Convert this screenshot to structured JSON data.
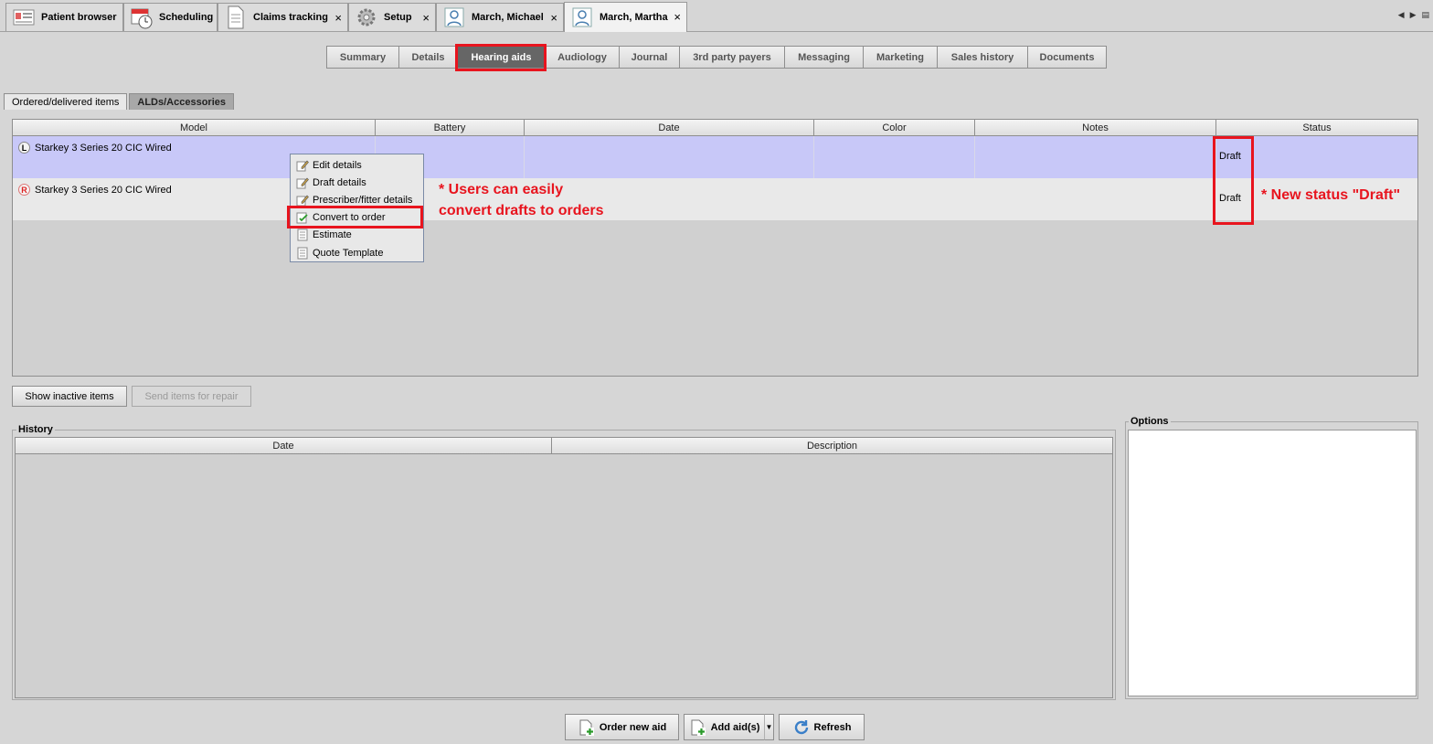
{
  "top_tabs": [
    {
      "label": "Patient browser",
      "icon": "patient-browser-icon",
      "closable": false,
      "active": false
    },
    {
      "label": "Scheduling",
      "icon": "calendar-clock-icon",
      "closable": false,
      "active": false
    },
    {
      "label": "Claims tracking",
      "icon": "document-icon",
      "closable": true,
      "active": false
    },
    {
      "label": "Setup",
      "icon": "gear-icon",
      "closable": true,
      "active": false
    },
    {
      "label": "March, Michael",
      "icon": "person-icon",
      "closable": true,
      "active": false
    },
    {
      "label": "March, Martha",
      "icon": "person-icon",
      "closable": true,
      "active": true
    }
  ],
  "close_glyph": "×",
  "sub_tabs": [
    "Summary",
    "Details",
    "Hearing aids",
    "Audiology",
    "Journal",
    "3rd party payers",
    "Messaging",
    "Marketing",
    "Sales history",
    "Documents"
  ],
  "sub_tabs_active": "Hearing aids",
  "inner_tabs": [
    "Ordered/delivered items",
    "ALDs/Accessories"
  ],
  "items_table": {
    "columns": [
      "Model",
      "Battery",
      "Date",
      "Color",
      "Notes",
      "Status"
    ],
    "rows": [
      {
        "side": "L",
        "model": "Starkey 3 Series 20 CIC Wired",
        "battery": "",
        "date": "",
        "color": "",
        "notes": "",
        "status": "Draft"
      },
      {
        "side": "R",
        "model": "Starkey 3 Series 20 CIC Wired",
        "battery": "",
        "date": "",
        "color": "",
        "notes": "",
        "status": "Draft"
      }
    ]
  },
  "context_menu": [
    {
      "label": "Edit details",
      "icon": "pencil-icon"
    },
    {
      "label": "Draft details",
      "icon": "pencil-icon"
    },
    {
      "label": "Prescriber/fitter details",
      "icon": "pencil-icon"
    },
    {
      "label": "Convert to order",
      "icon": "convert-check-icon"
    },
    {
      "label": "Estimate",
      "icon": "document-list-icon"
    },
    {
      "label": "Quote Template",
      "icon": "document-list-icon"
    }
  ],
  "annotations": {
    "convert_line1": "* Users can easily",
    "convert_line2": "convert drafts to orders",
    "status_note": "* New status \"Draft\"",
    "color": "#e8141e"
  },
  "buttons": {
    "show_inactive": "Show inactive items",
    "send_repair": "Send items for repair"
  },
  "history": {
    "title": "History",
    "columns": [
      "Date",
      "Description"
    ]
  },
  "options": {
    "title": "Options"
  },
  "bottom_buttons": {
    "order_new_aid": "Order new aid",
    "add_aids": "Add aid(s)",
    "refresh": "Refresh"
  }
}
